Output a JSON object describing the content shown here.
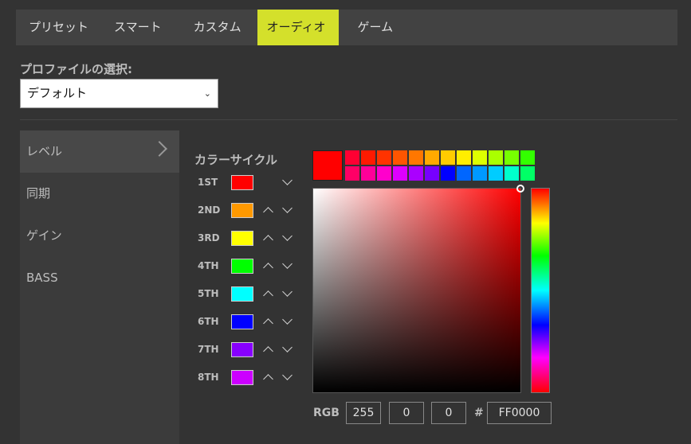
{
  "tabs": [
    {
      "label": "プリセット",
      "active": false
    },
    {
      "label": "スマート",
      "active": false
    },
    {
      "label": "カスタム",
      "active": false
    },
    {
      "label": "オーディオ",
      "active": true
    },
    {
      "label": "ゲーム",
      "active": false
    }
  ],
  "profile": {
    "label": "プロファイルの選択:",
    "value": "デフォルト"
  },
  "sidebar": {
    "items": [
      {
        "label": "レベル",
        "active": true
      },
      {
        "label": "同期",
        "active": false
      },
      {
        "label": "ゲイン",
        "active": false
      },
      {
        "label": "BASS",
        "active": false
      }
    ]
  },
  "cycle": {
    "title": "カラーサイクル",
    "rows": [
      {
        "label": "1ST",
        "color": "#ff0000",
        "up": false
      },
      {
        "label": "2ND",
        "color": "#ff9900",
        "up": true
      },
      {
        "label": "3RD",
        "color": "#ffff00",
        "up": true
      },
      {
        "label": "4TH",
        "color": "#00ff00",
        "up": true
      },
      {
        "label": "5TH",
        "color": "#00ffff",
        "up": true
      },
      {
        "label": "6TH",
        "color": "#0000ff",
        "up": true
      },
      {
        "label": "7TH",
        "color": "#8800ff",
        "up": true
      },
      {
        "label": "8TH",
        "color": "#cc00ff",
        "up": true
      }
    ]
  },
  "picker": {
    "current": "#ff0000",
    "presets_row1": [
      "#ff0033",
      "#ff1a00",
      "#ff3300",
      "#ff5500",
      "#ff7700",
      "#ffaa00",
      "#ffcc00",
      "#ffee00",
      "#ddff00",
      "#aaff00",
      "#77ff00",
      "#33ff00"
    ],
    "presets_row2": [
      "#ff0066",
      "#ff0099",
      "#ff00cc",
      "#dd00ff",
      "#aa00ff",
      "#7700ff",
      "#0000ff",
      "#0066ff",
      "#0099ff",
      "#00ccff",
      "#00ffcc",
      "#00ff66"
    ],
    "r": "255",
    "g": "0",
    "b": "0",
    "rgb_label": "RGB",
    "hash": "#",
    "hex": "FF0000"
  }
}
